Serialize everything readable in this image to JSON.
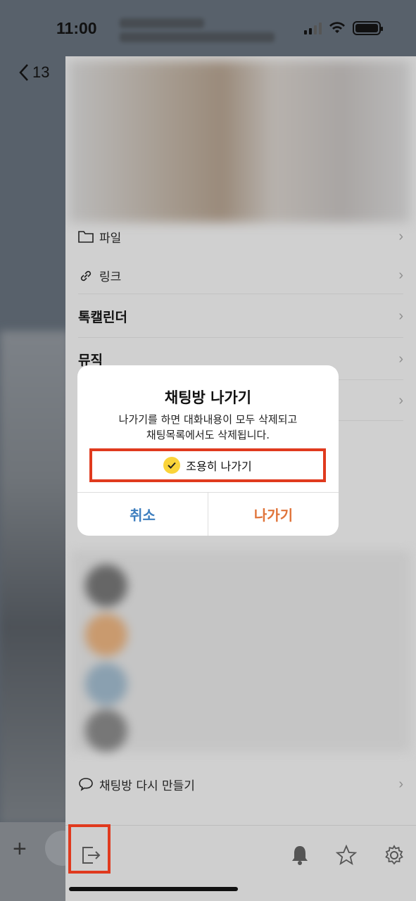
{
  "status_bar": {
    "time": "11:00"
  },
  "chat_header": {
    "back_count": "13"
  },
  "drawer": {
    "menu": [
      {
        "label": "파일",
        "icon": "folder-icon"
      },
      {
        "label": "링크",
        "icon": "link-icon"
      },
      {
        "label": "톡캘린더"
      },
      {
        "label": "뮤직"
      }
    ],
    "remake_label": "채팅방 다시 만들기",
    "footer_icons": [
      "exit-icon",
      "bell-icon",
      "star-icon",
      "gear-icon"
    ]
  },
  "dialog": {
    "title": "채팅방 나가기",
    "message_line1": "나가기를 하면 대화내용이 모두 삭제되고",
    "message_line2": "채팅목록에서도 삭제됩니다.",
    "quiet_leave_label": "조용히 나가기",
    "quiet_leave_checked": true,
    "cancel_label": "취소",
    "leave_label": "나가기"
  },
  "colors": {
    "highlight": "#e03a1e",
    "cancel": "#3f7fbf",
    "leave": "#e0743a",
    "check": "#fad43a"
  }
}
